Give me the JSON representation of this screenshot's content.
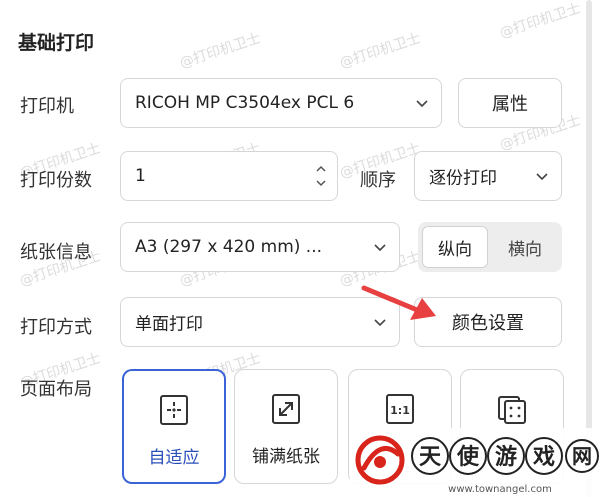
{
  "section": {
    "title": "基础打印"
  },
  "printer": {
    "label": "打印机",
    "value": "RICOH MP C3504ex PCL 6",
    "properties_button": "属性"
  },
  "copies": {
    "label": "打印份数",
    "value": "1",
    "order_label": "顺序",
    "order_value": "逐份打印"
  },
  "paper": {
    "label": "纸张信息",
    "value": "A3 (297 x 420 mm) ...",
    "orientation": [
      "纵向",
      "横向"
    ],
    "orientation_selected": "纵向"
  },
  "mode": {
    "label": "打印方式",
    "value": "单面打印",
    "color_button": "颜色设置"
  },
  "layout": {
    "label": "页面布局",
    "tiles": [
      "自适应",
      "铺满纸张",
      "",
      ""
    ],
    "selected": "自适应"
  },
  "watermark": {
    "text": "@打印机卫士"
  },
  "site_logo": {
    "name": "天使游戏网",
    "url": "www.townangel.com"
  },
  "colors": {
    "accent": "#3b63d8",
    "arrow": "#e84040",
    "logo_red": "#d9241c"
  },
  "icons": {
    "dropdown": "chevron-down-icon",
    "stepper": "stepper-icon",
    "fit": "fit-to-page-icon",
    "fill": "fill-paper-icon",
    "actual": "actual-size-icon",
    "multi": "multi-page-icon"
  }
}
